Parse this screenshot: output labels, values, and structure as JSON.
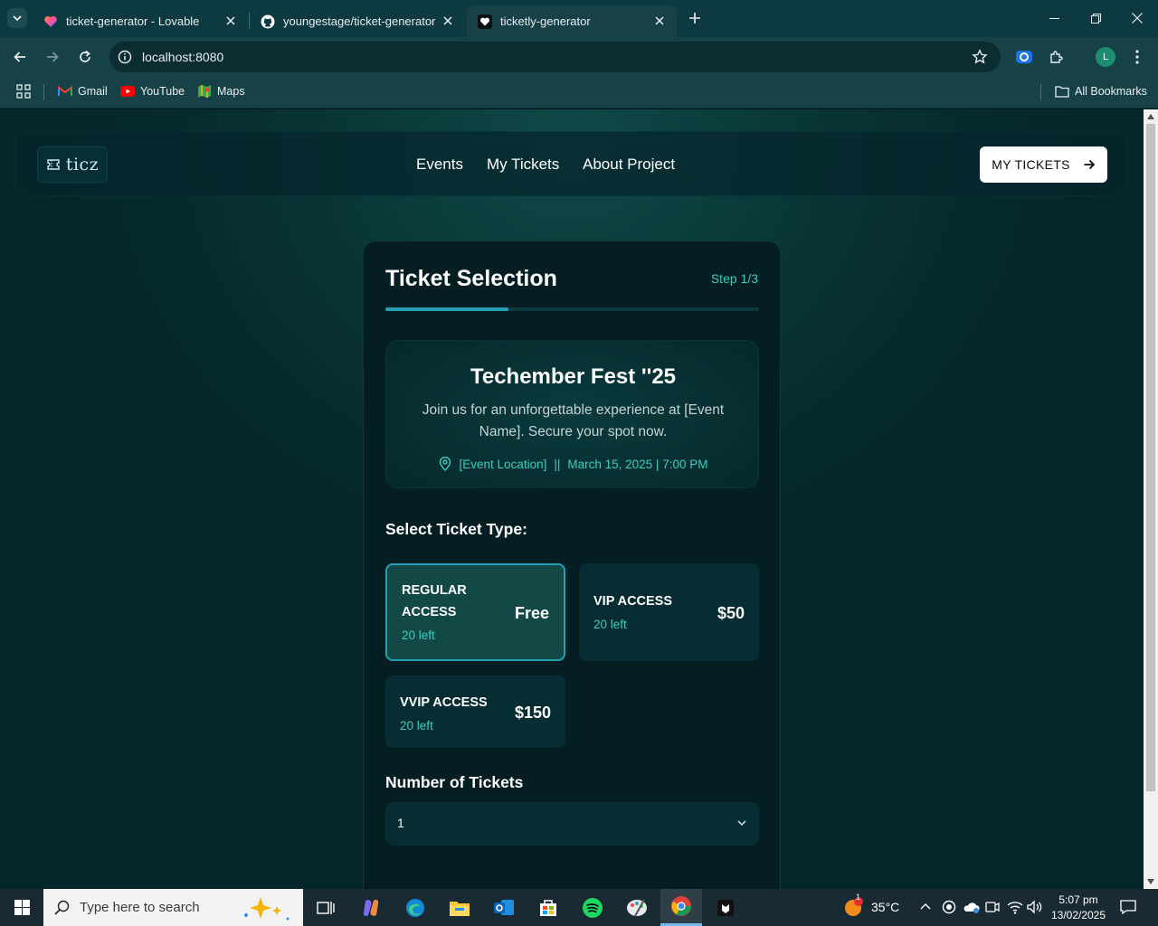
{
  "browser": {
    "tabs": [
      {
        "title": "ticket-generator - Lovable",
        "icon": "lovable-heart-icon"
      },
      {
        "title": "youngestage/ticket-generator",
        "icon": "github-icon"
      },
      {
        "title": "ticketly-generator",
        "icon": "heart-icon",
        "active": true
      }
    ],
    "url": "localhost:8080",
    "profile_initial": "L",
    "bookmarks": [
      {
        "label": "Gmail",
        "icon": "gmail-icon"
      },
      {
        "label": "YouTube",
        "icon": "youtube-icon"
      },
      {
        "label": "Maps",
        "icon": "maps-icon"
      }
    ],
    "all_bookmarks": "All Bookmarks"
  },
  "site": {
    "logo_text": "ticz",
    "nav": [
      "Events",
      "My Tickets",
      "About Project"
    ],
    "cta_label": "MY TICKETS"
  },
  "card": {
    "title": "Ticket Selection",
    "step": "Step 1/3",
    "progress": 0.33,
    "event": {
      "name": "Techember Fest ''25",
      "description": "Join us for an unforgettable experience at [Event Name]. Secure your spot now.",
      "location": "[Event Location]",
      "separator": "||",
      "datetime": "March 15, 2025 | 7:00 PM"
    },
    "ticket_type_label": "Select Ticket Type:",
    "tickets": [
      {
        "name": "REGULAR ACCESS",
        "left": "20 left",
        "price": "Free",
        "selected": true
      },
      {
        "name": "VIP ACCESS",
        "left": "20 left",
        "price": "$50",
        "selected": false
      },
      {
        "name": "VVIP ACCESS",
        "left": "20 left",
        "price": "$150",
        "selected": false
      }
    ],
    "quantity_label": "Number of Tickets",
    "quantity_value": "1"
  },
  "taskbar": {
    "search_placeholder": "Type here to search",
    "weather": "35°C",
    "weather_badge": "1",
    "time": "5:07 pm",
    "date": "13/02/2025"
  },
  "colors": {
    "accent": "#24a0b5",
    "accent_text": "#3ccdbd",
    "card_bg": "#041e23",
    "selected_ticket_bg": "#124947"
  }
}
